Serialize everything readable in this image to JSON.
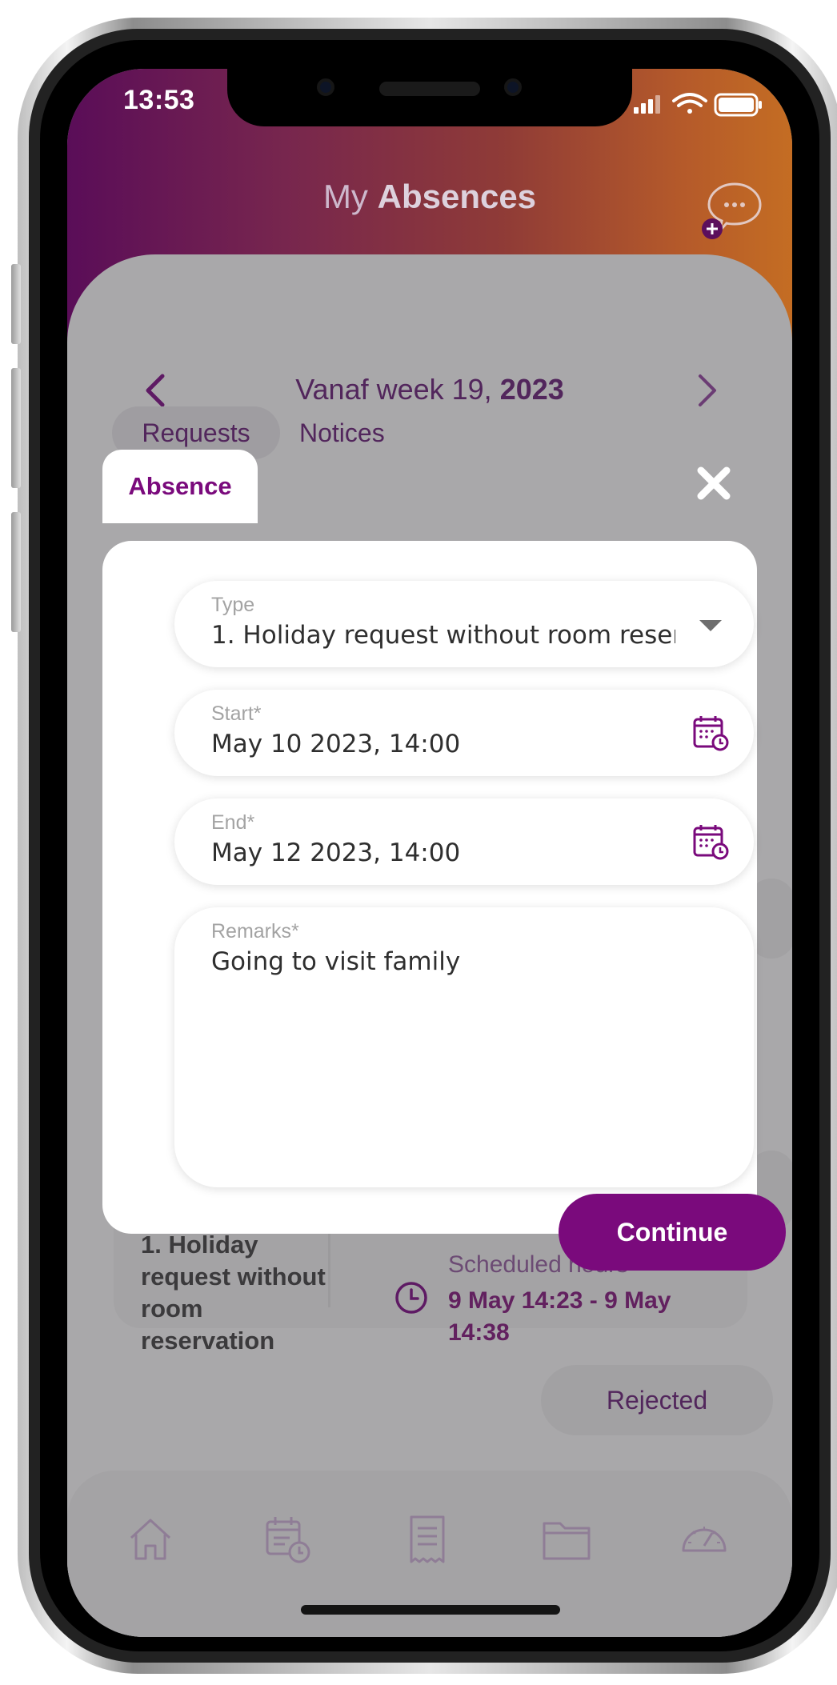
{
  "status_bar": {
    "time": "13:53"
  },
  "header": {
    "title_light": "My",
    "title_bold": "Absences"
  },
  "week_nav": {
    "label_prefix": "Vanaf week 19,",
    "year": "2023"
  },
  "tabs": [
    {
      "label": "Requests",
      "active": true
    },
    {
      "label": "Notices",
      "active": false
    }
  ],
  "background_request": {
    "type": "1. Holiday request without room reservation",
    "hours_label": "Scheduled hours",
    "hours_value": "9 May 14:23 - 9 May 14:38",
    "status": "Rejected"
  },
  "bottom_nav": {
    "icons": [
      "home-icon",
      "calendar-clock-icon",
      "receipt-icon",
      "folder-icon",
      "speedometer-icon"
    ]
  },
  "modal": {
    "tab_label": "Absence",
    "fields": {
      "type": {
        "label": "Type",
        "value": "1. Holiday request without room reser"
      },
      "start": {
        "label": "Start*",
        "value": "May 10 2023, 14:00"
      },
      "end": {
        "label": "End*",
        "value": "May 12 2023, 14:00"
      },
      "remarks": {
        "label": "Remarks*",
        "value": "Going to visit family"
      }
    },
    "continue_label": "Continue"
  },
  "colors": {
    "brand": "#7a0a7c",
    "header_gradient_start": "#5a0d58",
    "header_gradient_end": "#c46d23"
  }
}
